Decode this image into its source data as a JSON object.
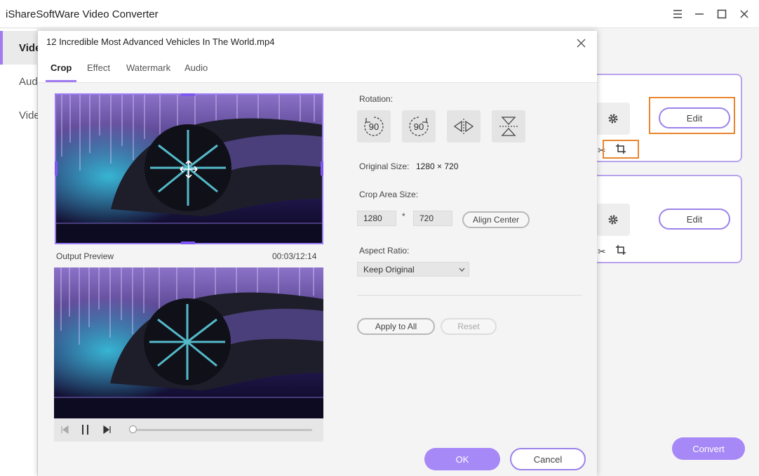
{
  "app": {
    "title": "iShareSoftWare Video Converter"
  },
  "sidebar": {
    "items": [
      {
        "label": "Video"
      },
      {
        "label": "Audio"
      },
      {
        "label": "Video"
      }
    ]
  },
  "cards": [
    {
      "edit_label": "Edit"
    },
    {
      "edit_label": "Edit"
    }
  ],
  "footer": {
    "convert_label": "Convert"
  },
  "dialog": {
    "title": "12 Incredible Most Advanced Vehicles In The World.mp4",
    "tabs": [
      {
        "label": "Crop"
      },
      {
        "label": "Effect"
      },
      {
        "label": "Watermark"
      },
      {
        "label": "Audio"
      }
    ],
    "active_tab": "Crop",
    "preview": {
      "output_label": "Output Preview",
      "time": "00:03/12:14",
      "progress": 0.0
    },
    "rotation": {
      "label": "Rotation:",
      "rotate_left_text": "90",
      "rotate_right_text": "90"
    },
    "original_size": {
      "label": "Original Size:",
      "value": "1280 × 720"
    },
    "crop_area": {
      "label": "Crop Area Size:",
      "width": "1280",
      "sep": "*",
      "height": "720",
      "align_center_label": "Align Center"
    },
    "aspect_ratio": {
      "label": "Aspect Ratio:",
      "selected": "Keep Original"
    },
    "apply_all_label": "Apply to All",
    "reset_label": "Reset",
    "ok_label": "OK",
    "cancel_label": "Cancel"
  },
  "colors": {
    "accent": "#a688f6",
    "highlight": "#e8862e",
    "card_border": "#b9a2ee"
  }
}
